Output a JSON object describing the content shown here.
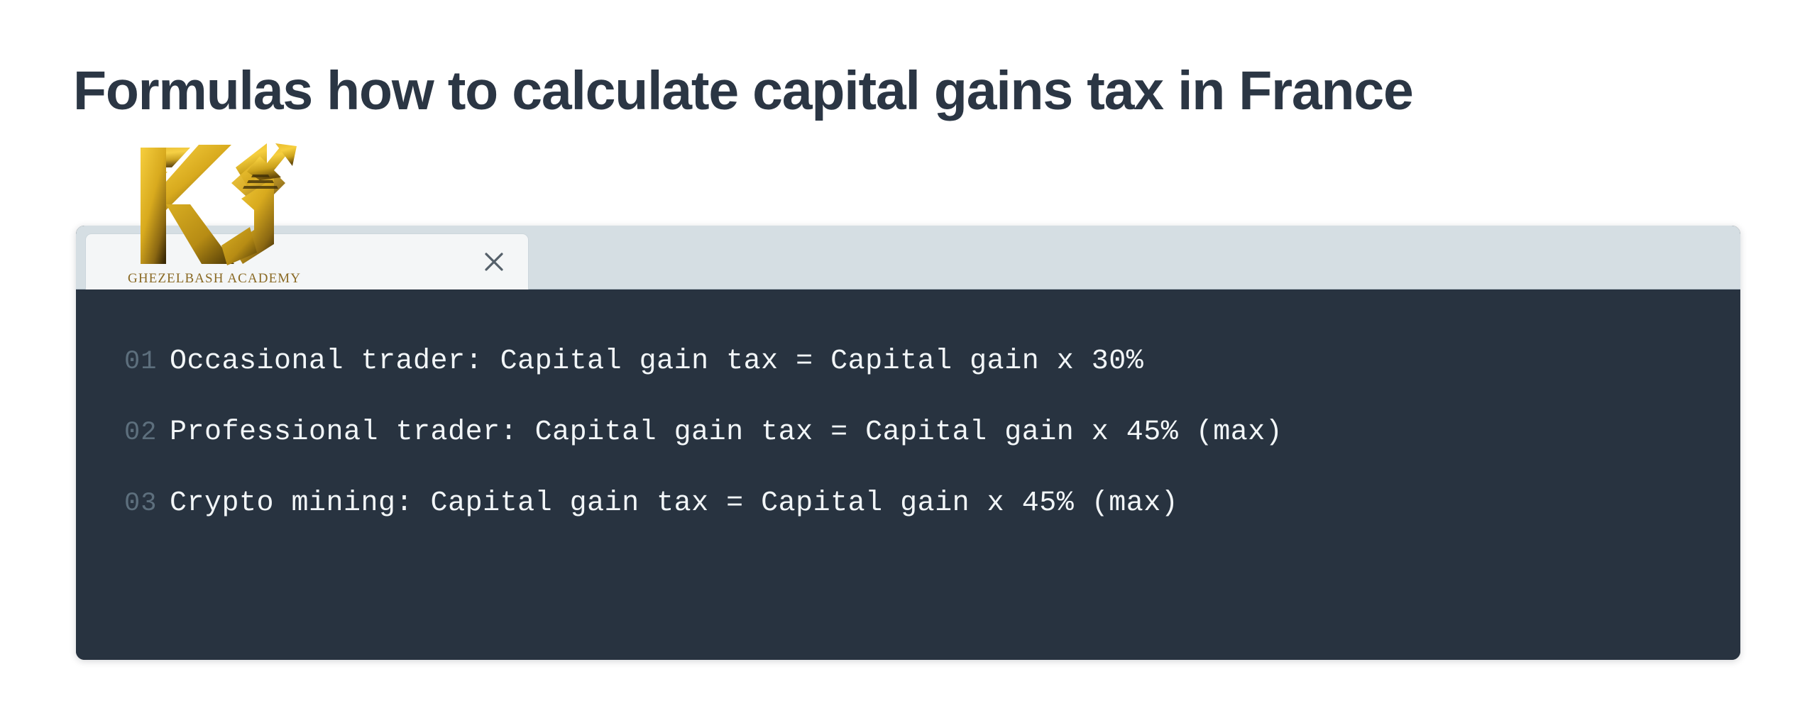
{
  "page": {
    "title": "Formulas how to calculate capital gains tax in France",
    "background_color": "#ffffff",
    "title_color": "#2b3644"
  },
  "watermark": {
    "logo_name": "kg-monogram",
    "caption": "GHEZELBASH ACADEMY",
    "gold_light": "#f4c939",
    "gold_mid": "#d4a017",
    "gold_dark": "#5a4208"
  },
  "code_window": {
    "header": {
      "background_color": "#d5dee3",
      "tab": {
        "label": "",
        "active": true,
        "close_icon": "close-icon",
        "close_glyph": "✕",
        "background_color": "#f4f6f7"
      }
    },
    "body": {
      "background_color": "#283340",
      "text_color": "#f2f6f8",
      "line_number_color": "#5d6f7d",
      "lines": [
        {
          "number": "01",
          "code": "Occasional trader: Capital gain tax = Capital gain x 30%"
        },
        {
          "number": "02",
          "code": "Professional trader: Capital gain tax = Capital gain x 45% (max)"
        },
        {
          "number": "03",
          "code": "Crypto mining: Capital gain tax = Capital gain x 45% (max)"
        }
      ]
    }
  }
}
